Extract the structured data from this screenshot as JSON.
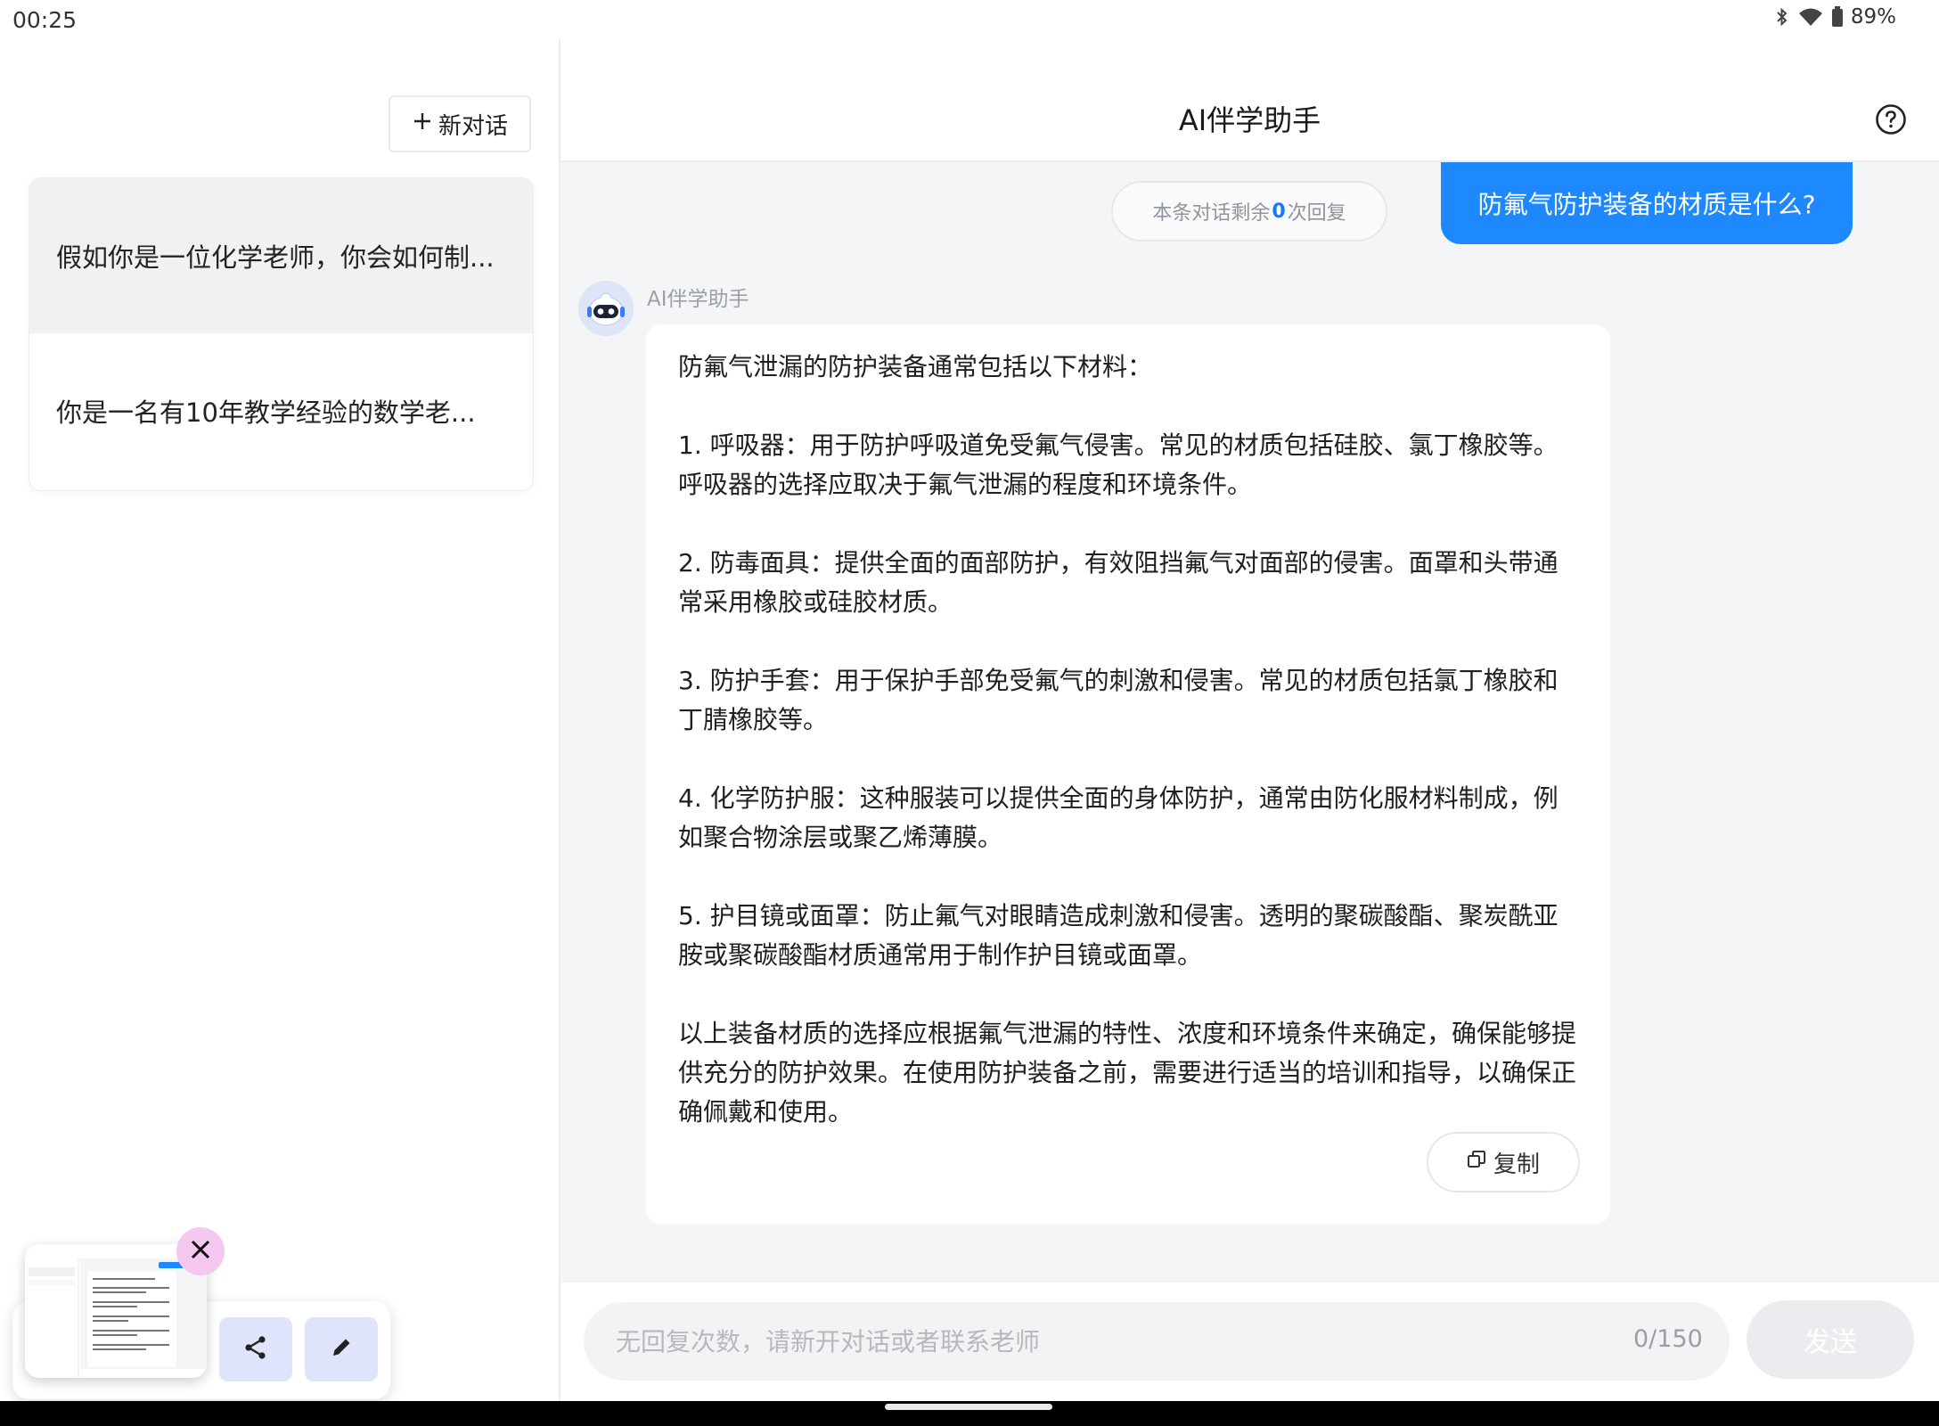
{
  "status_bar": {
    "time": "00:25",
    "battery": "89%",
    "icons": [
      "bluetooth-icon",
      "wifi-icon",
      "battery-icon"
    ]
  },
  "sidebar": {
    "new_chat_label": "新对话",
    "conversations": [
      {
        "title": "假如你是一位化学老师，你会如何制...",
        "active": true
      },
      {
        "title": "你是一名有10年教学经验的数学老...",
        "active": false
      }
    ]
  },
  "header": {
    "title": "AI伴学助手"
  },
  "chat": {
    "remaining_prefix": "本条对话剩余",
    "remaining_count": "0",
    "remaining_suffix": "次回复",
    "user_message": "防氟气防护装备的材质是什么?",
    "assistant_name": "AI伴学助手",
    "answer_paragraphs": [
      "防氟气泄漏的防护装备通常包括以下材料：",
      "1. 呼吸器：用于防护呼吸道免受氟气侵害。常见的材质包括硅胶、氯丁橡胶等。呼吸器的选择应取决于氟气泄漏的程度和环境条件。",
      "2. 防毒面具：提供全面的面部防护，有效阻挡氟气对面部的侵害。面罩和头带通常采用橡胶或硅胶材质。",
      "3. 防护手套：用于保护手部免受氟气的刺激和侵害。常见的材质包括氯丁橡胶和丁腈橡胶等。",
      "4. 化学防护服：这种服装可以提供全面的身体防护，通常由防化服材料制成，例如聚合物涂层或聚乙烯薄膜。",
      "5. 护目镜或面罩：防止氟气对眼睛造成刺激和侵害。透明的聚碳酸酯、聚炭酰亚胺或聚碳酸酯材质通常用于制作护目镜或面罩。",
      "以上装备材质的选择应根据氟气泄漏的特性、浓度和环境条件来确定，确保能够提供充分的防护效果。在使用防护装备之前，需要进行适当的培训和指导，以确保正确佩戴和使用。"
    ],
    "copy_label": "复制"
  },
  "input": {
    "placeholder": "无回复次数，请新开对话或者联系老师",
    "char_count": "0/150",
    "send_label": "发送"
  },
  "colors": {
    "accent": "#1e88ff",
    "chat_bg": "#f4f5f7",
    "active_item_bg": "#f0f1f3"
  }
}
